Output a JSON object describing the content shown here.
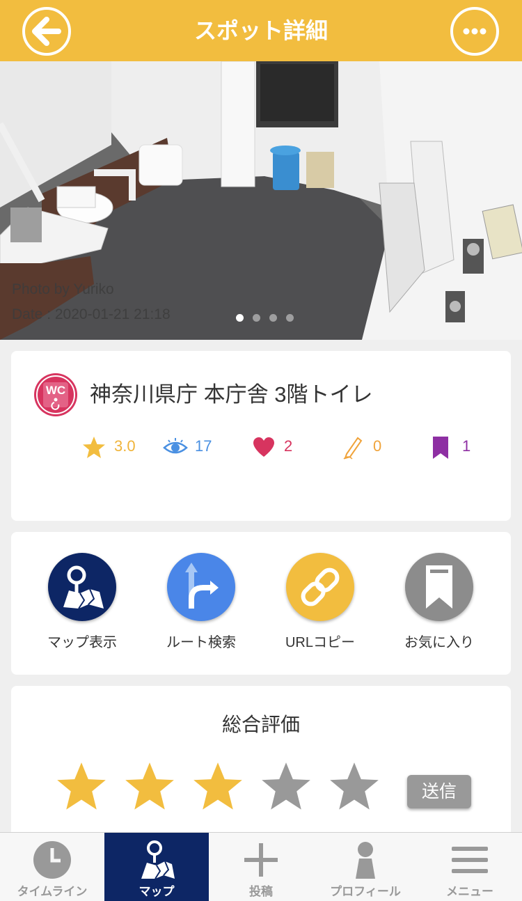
{
  "header": {
    "title": "スポット詳細",
    "color": "#f2bd3f"
  },
  "photo": {
    "by": "Photo by  Yuriko",
    "date": "Date :  2020-01-21 21:18",
    "page_count": 4,
    "current_page": 1
  },
  "spot": {
    "name": "神奈川県庁 本庁舎 3階トイレ",
    "category_icon": "wc-accessible-icon",
    "stats": {
      "rating": "3.0",
      "views": "17",
      "likes": "2",
      "posts": "0",
      "bookmarks": "1"
    }
  },
  "actions": {
    "map": "マップ表示",
    "route": "ルート検索",
    "url_copy": "URLコピー",
    "favorite": "お気に入り"
  },
  "rating": {
    "title": "総合評価",
    "value": 3,
    "max": 5,
    "submit": "送信"
  },
  "tabs": {
    "timeline": "タイムライン",
    "map": "マップ",
    "post": "投稿",
    "profile": "プロフィール",
    "menu": "メニュー",
    "active": "map"
  }
}
